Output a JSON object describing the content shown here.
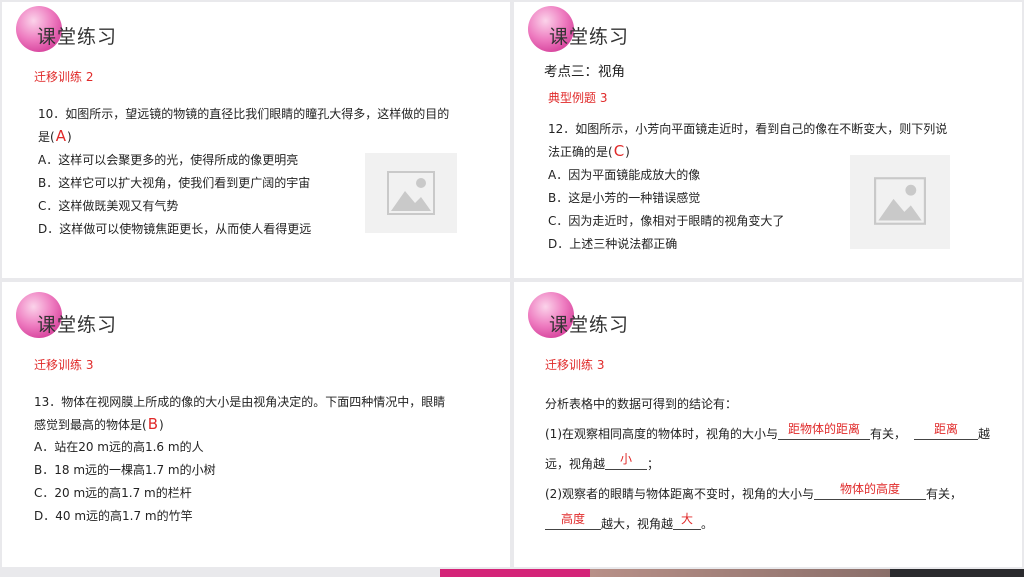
{
  "colors": {
    "accent": "#c81f86",
    "answer": "#e02a2a"
  },
  "panel1": {
    "title": "课堂练习",
    "subtitle": "迁移训练 2",
    "question_text": "10．如图所示，望远镜的物镜的直径比我们眼睛的瞳孔大得多，这样做的目的",
    "answer_prefix": "是(",
    "answer": "A",
    "answer_suffix": ")",
    "options": [
      "A．这样可以会聚更多的光，使得所成的像更明亮",
      "B．这样它可以扩大视角，使我们看到更广阔的宇宙",
      "C．这样做既美观又有气势",
      "D．这样做可以使物镜焦距更长，从而使人看得更远"
    ]
  },
  "panel2": {
    "title": "课堂练习",
    "heading": "考点三：视角",
    "subtitle": "典型例题 3",
    "question_text": "12．如图所示，小芳向平面镜走近时，看到自己的像在不断变大，则下列说",
    "answer_prefix": "法正确的是(",
    "answer": "C",
    "answer_suffix": ")",
    "options": [
      "A．因为平面镜能成放大的像",
      "B．这是小芳的一种错误感觉",
      "C．因为走近时，像相对于眼睛的视角变大了",
      "D．上述三种说法都正确"
    ]
  },
  "panel3": {
    "title": "课堂练习",
    "subtitle": "迁移训练 3",
    "question_text": "13．物体在视网膜上所成的像的大小是由视角决定的。下面四种情况中，眼睛",
    "answer_prefix": "感觉到最高的物体是(",
    "answer": "B",
    "answer_suffix": ")",
    "options": [
      "A．站在20 m远的高1.6 m的人",
      "B．18 m远的一棵高1.7 m的小树",
      "C．20 m远的高1.7 m的栏杆",
      "D．40 m远的高1.7 m的竹竿"
    ]
  },
  "panel4": {
    "title": "课堂练习",
    "subtitle": "迁移训练 3",
    "intro": "分析表格中的数据可得到的结论有：",
    "line1_a": "(1)在观察相同高度的物体时，视角的大小与",
    "blank1": "距物体的距离",
    "line1_b": "有关，",
    "blank2": "距离",
    "line1_c": "越",
    "line2_a": "远，视角越",
    "blank3": "小",
    "line2_b": "；",
    "line3_a": "(2)观察者的眼睛与物体距离不变时，视角的大小与",
    "blank4": "物体的高度",
    "line3_b": "有关，",
    "blank5": "高度",
    "line4_a": "越大，视角越",
    "blank6": "大",
    "line4_b": "。"
  }
}
